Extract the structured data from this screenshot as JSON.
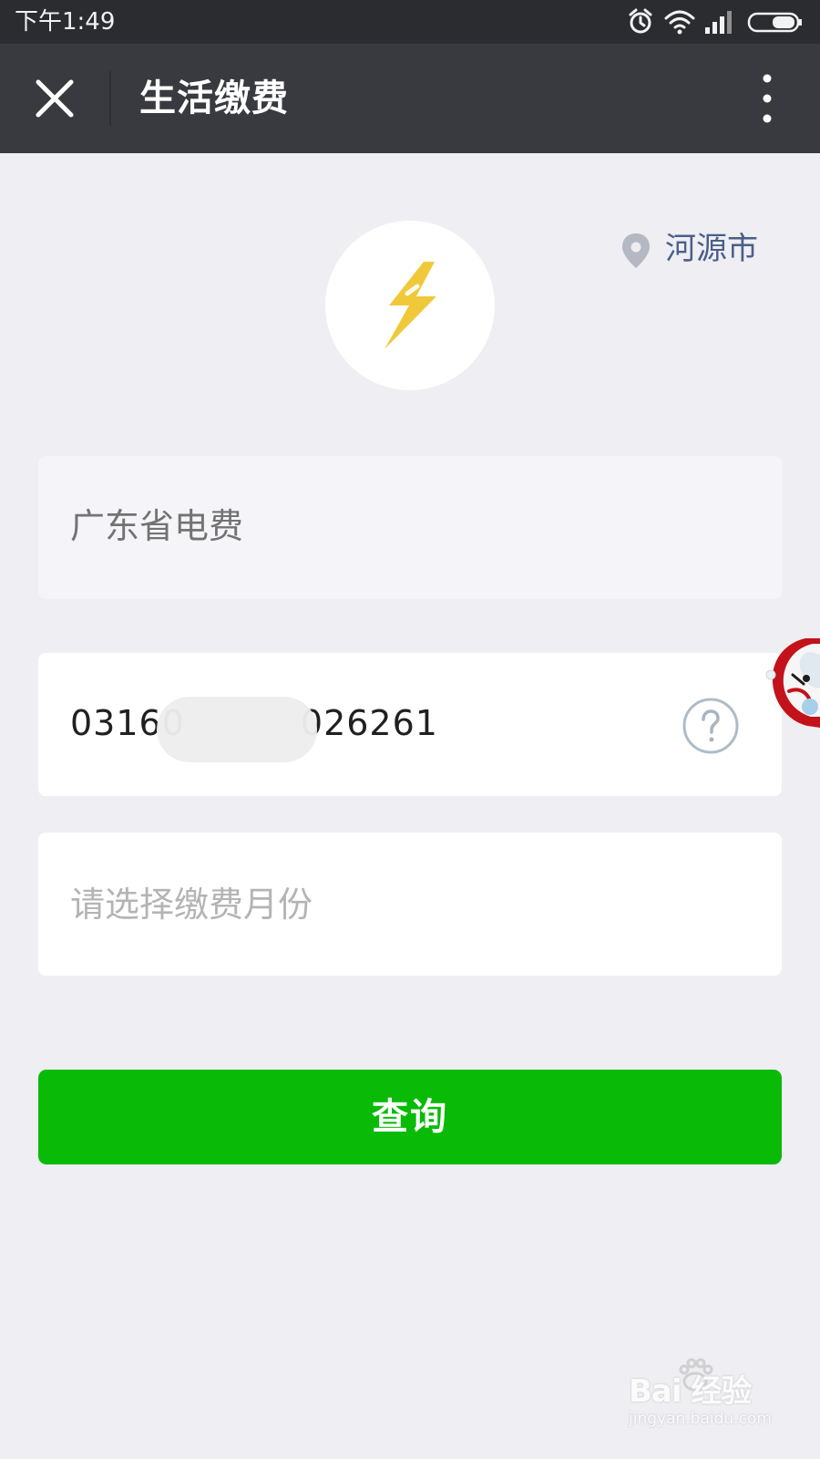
{
  "status_bar": {
    "time": "下午1:49",
    "icons": [
      "alarm-icon",
      "wifi-icon",
      "signal-icon",
      "battery-icon"
    ]
  },
  "app_bar": {
    "title": "生活缴费",
    "close_icon": "close-icon",
    "more_icon": "more-vertical-icon"
  },
  "header": {
    "category_icon": "lightning-icon",
    "location": "河源市",
    "location_icon": "location-pin-icon"
  },
  "form": {
    "provider": "广东省电费",
    "account_prefix": "03160",
    "account_suffix": "026261",
    "account_help_icon": "help-circle-icon",
    "month_placeholder": "请选择缴费月份",
    "query_label": "查询"
  },
  "watermark": {
    "main": "Bai 经验",
    "sub": "jingyan.baidu.com"
  },
  "colors": {
    "status_bar": "#2a2c30",
    "app_bar": "#393a3f",
    "background": "#eeeef3",
    "primary_button": "#09bb07",
    "lightning": "#f0c93a",
    "location_text": "#4a5f88"
  }
}
